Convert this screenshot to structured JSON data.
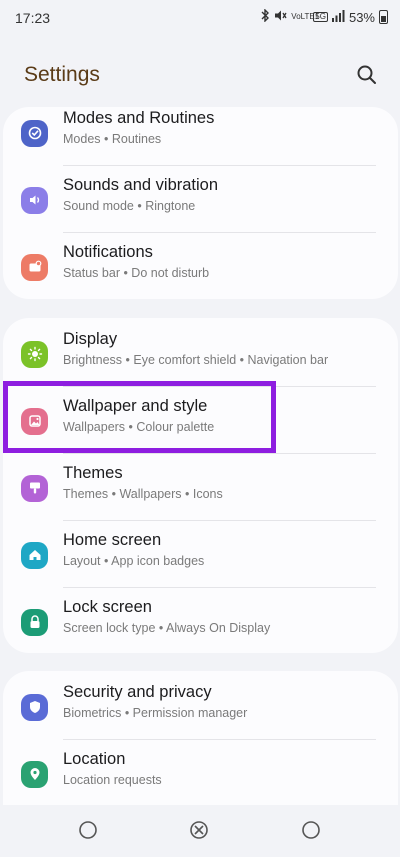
{
  "status": {
    "time": "17:23",
    "battery": "53%",
    "icons": [
      "bluetooth-icon",
      "mute-icon",
      "volte-icon",
      "5g-icon",
      "signal-icon",
      "battery-icon"
    ],
    "volte_label": "VoLTE1",
    "network_label": "5G"
  },
  "header": {
    "title": "Settings",
    "search_icon": "search-icon"
  },
  "colors": {
    "title": "#5a3b17",
    "highlight": "#8e1ee0",
    "modes": "#4e64c8",
    "sounds": "#8b7ee8",
    "notifications": "#ed7b66",
    "display": "#7bc228",
    "wallpaper": "#e46f8e",
    "themes": "#b363d6",
    "home": "#1ea7c5",
    "lock": "#1c9c76",
    "security": "#5a6bd6",
    "location": "#2aa272"
  },
  "groups": [
    {
      "items": [
        {
          "title": "Modes and Routines",
          "subtitle": "Modes • Routines",
          "icon": "modes-check-icon"
        },
        {
          "title": "Sounds and vibration",
          "subtitle": "Sound mode • Ringtone",
          "icon": "speaker-icon"
        },
        {
          "title": "Notifications",
          "subtitle": "Status bar • Do not disturb",
          "icon": "notification-icon"
        }
      ]
    },
    {
      "items": [
        {
          "title": "Display",
          "subtitle": "Brightness • Eye comfort shield • Navigation bar",
          "icon": "sun-icon"
        },
        {
          "title": "Wallpaper and style",
          "subtitle": "Wallpapers • Colour palette",
          "icon": "wallpaper-icon"
        },
        {
          "title": "Themes",
          "subtitle": "Themes • Wallpapers • Icons",
          "icon": "brush-icon"
        },
        {
          "title": "Home screen",
          "subtitle": "Layout • App icon badges",
          "icon": "home-icon"
        },
        {
          "title": "Lock screen",
          "subtitle": "Screen lock type • Always On Display",
          "icon": "lock-icon"
        }
      ]
    },
    {
      "items": [
        {
          "title": "Security and privacy",
          "subtitle": "Biometrics • Permission manager",
          "icon": "shield-icon"
        },
        {
          "title": "Location",
          "subtitle": "Location requests",
          "icon": "location-pin-icon"
        }
      ]
    }
  ],
  "navbar": {
    "icons": [
      "recents-icon",
      "home-nav-icon",
      "back-icon"
    ]
  }
}
